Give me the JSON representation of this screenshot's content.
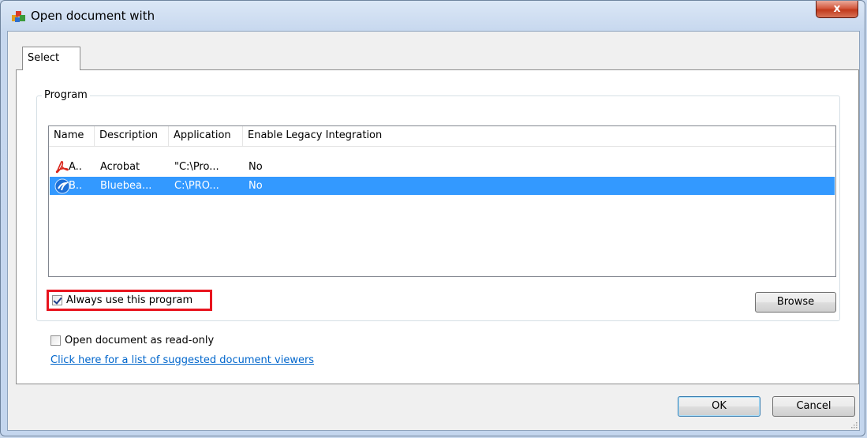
{
  "window": {
    "title": "Open document with",
    "close_label": "x"
  },
  "tabs": [
    {
      "label": "Select",
      "active": true
    }
  ],
  "program_group": {
    "legend": "Program",
    "columns": [
      "Name",
      "Description",
      "Application",
      "Enable Legacy Integration"
    ],
    "rows": [
      {
        "icon": "acrobat-icon",
        "name": "A..",
        "description": "Acrobat",
        "application": "\"C:\\Pro...",
        "legacy": "No",
        "selected": false
      },
      {
        "icon": "bluebeam-icon",
        "name": "B..",
        "description": "Bluebea...",
        "application": "C:\\PRO...",
        "legacy": "No",
        "selected": true
      }
    ],
    "always_use": {
      "label": "Always use this program",
      "checked": true
    },
    "browse_label": "Browse"
  },
  "read_only": {
    "label": "Open document as read-only",
    "checked": false
  },
  "viewers_link": "Click here for a list of suggested document viewers",
  "footer": {
    "ok_label": "OK",
    "cancel_label": "Cancel"
  },
  "colors": {
    "selection": "#3399ff",
    "highlight_border": "#e8141e",
    "link": "#0066cc",
    "close_button": "#c13a1c"
  }
}
